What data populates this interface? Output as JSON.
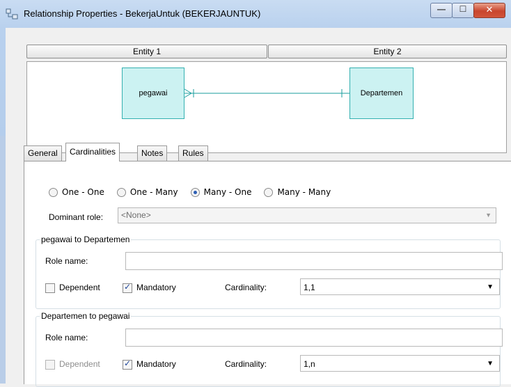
{
  "window": {
    "title": "Relationship Properties - BekerjaUntuk (BEKERJAUNTUK)",
    "icons": [
      "app-icon",
      "minimize-icon",
      "maximize-icon",
      "close-icon"
    ]
  },
  "entities": {
    "header1": "Entity 1",
    "header2": "Entity 2",
    "entity1_name": "pegawai",
    "entity2_name": "Departemen"
  },
  "tabs": [
    {
      "label": "General"
    },
    {
      "label": "Cardinalities"
    },
    {
      "label": "Notes"
    },
    {
      "label": "Rules"
    }
  ],
  "cardinality_options": [
    {
      "label": "One - One",
      "selected": false
    },
    {
      "label": "One - Many",
      "selected": false
    },
    {
      "label": "Many - One",
      "selected": true
    },
    {
      "label": "Many - Many",
      "selected": false
    }
  ],
  "dominant_role": {
    "label": "Dominant role:",
    "value": "<None>"
  },
  "group1": {
    "title": "pegawai to Departemen",
    "role_label": "Role name:",
    "role_value": "",
    "dependent_label": "Dependent",
    "dependent_checked": false,
    "mandatory_label": "Mandatory",
    "mandatory_checked": true,
    "cardinality_label": "Cardinality:",
    "cardinality_value": "1,1"
  },
  "group2": {
    "title": "Departemen to pegawai",
    "role_label": "Role name:",
    "role_value": "",
    "dependent_label": "Dependent",
    "dependent_checked": false,
    "dependent_disabled": true,
    "mandatory_label": "Mandatory",
    "mandatory_checked": true,
    "cardinality_label": "Cardinality:",
    "cardinality_value": "1,n"
  },
  "colors": {
    "entity_fill": "#ccf2f2",
    "entity_border": "#33b0b0",
    "relationship_line": "#1a9e9e",
    "radio_selected": "#2d5fb4"
  }
}
